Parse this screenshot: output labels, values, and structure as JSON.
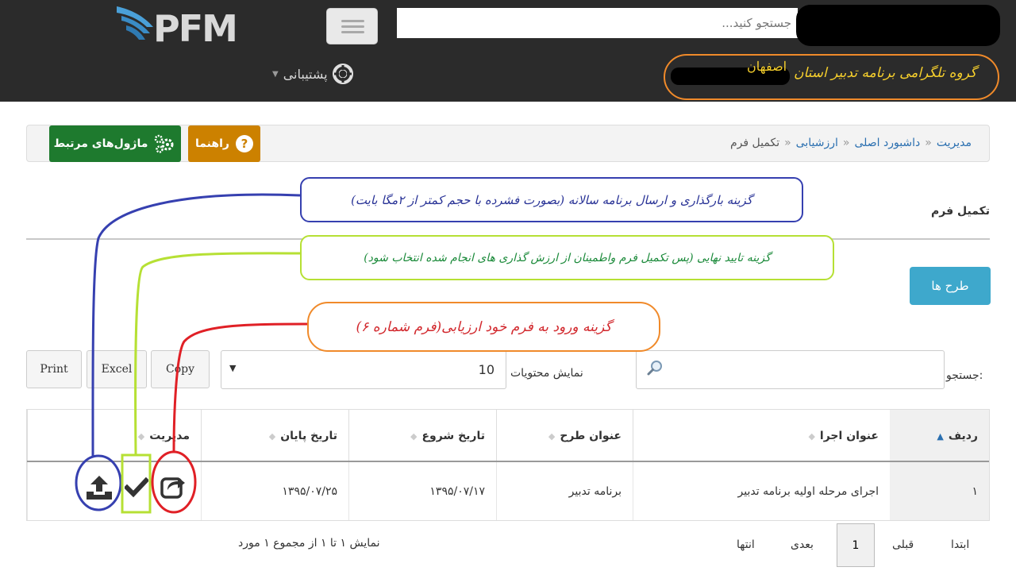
{
  "header": {
    "logo_text": "PFM",
    "search_placeholder": "جستجو کنید...",
    "support_label": "پشتیبانی",
    "telegram_group": "گروه تلگرامی برنامه تدبیر استان",
    "telegram_city": "اصفهان"
  },
  "breadcrumb": {
    "items": [
      "مدیریت",
      "داشبورد اصلی",
      "ارزشیابی",
      "تکمیل فرم"
    ],
    "separator": "«"
  },
  "actions_bar": {
    "help_label": "راهنما",
    "modules_label": "ماژول‌های مرتبط"
  },
  "page": {
    "title": "تکمیل فرم",
    "plans_button": "طرح ها"
  },
  "table_controls": {
    "print": "Print",
    "excel": "Excel",
    "copy": "Copy",
    "page_length_value": "10",
    "page_length_label": "نمایش محتویات",
    "search_label": "جستجو:"
  },
  "table": {
    "columns": [
      "ردیف",
      "عنوان اجرا",
      "عنوان طرح",
      "تاریخ شروع",
      "تاریخ پایان",
      "مدیریت"
    ],
    "rows": [
      {
        "row_num": "۱",
        "exec_title": "اجرای مرحله اولیه برنامه تدبیر",
        "plan_title": "برنامه تدبیر",
        "start_date": "۱۳۹۵/۰۷/۱۷",
        "end_date": "۱۳۹۵/۰۷/۲۵"
      }
    ]
  },
  "pagination": {
    "info": "نمایش ۱ تا ۱ از مجموع ۱ مورد",
    "first": "ابتدا",
    "prev": "قبلی",
    "current": "1",
    "next": "بعدی",
    "last": "انتها"
  },
  "annotations": {
    "upload_note": "گزینه بارگذاری و ارسال برنامه سالانه (بصورت فشرده با حجم کمتر از ۲مگا بایت)",
    "confirm_note": "گزینه تایید نهایی (پس تکمیل فرم واطمینان از ارزش گذاری های انجام شده انتخاب شود)",
    "enter_note": "گزینه ورود به فرم خود ارزیابی(فرم شماره ۶)"
  },
  "colors": {
    "topbar": "#2b2b2b",
    "link": "#2a6fb0",
    "help_button": "#cc8100",
    "modules_button": "#1e7a2e",
    "plans_button": "#3ea8cc",
    "annotation_blue": "#3640b0",
    "annotation_green": "#b6e034",
    "annotation_orange": "#f08a2a",
    "annotation_red": "#e02026"
  }
}
